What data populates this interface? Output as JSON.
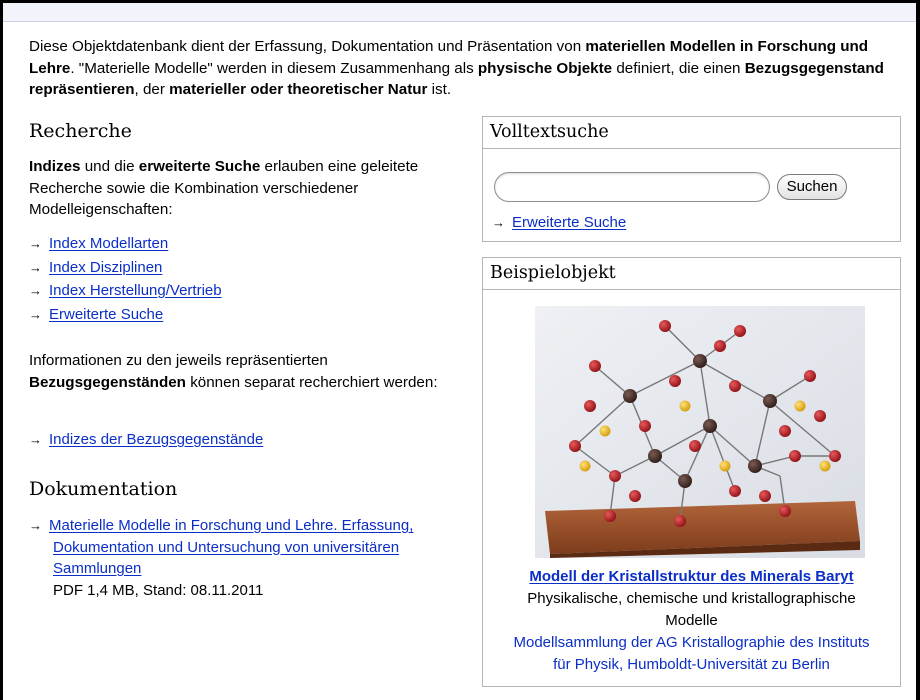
{
  "intro": {
    "p1": "Diese Objektdatenbank dient der Erfassung, Dokumentation und Präsentation von ",
    "b1": "materiellen Modellen in Forschung und Lehre",
    "p2": ". \"Materielle Modelle\" werden in diesem Zusammenhang als ",
    "b2": "physische Objekte",
    "p3": " definiert, die einen ",
    "b3": "Bezugsgegenstand repräsentieren",
    "p4": ", der ",
    "b4": "materieller oder theoretischer Natur",
    "p5": " ist."
  },
  "recherche": {
    "heading": "Recherche",
    "b1": "Indizes",
    "p1": " und die ",
    "b2": "erweiterte Suche",
    "p2": " erlauben eine geleitete Recherche sowie die Kombination verschiedener Modelleigenschaften:",
    "links": [
      "Index Modellarten",
      "Index Disziplinen",
      "Index Herstellung/Vertrieb",
      "Erweiterte Suche"
    ],
    "info_p1": "Informationen zu den jeweils repräsentierten ",
    "info_b": "Bezugsgegenständen",
    "info_p2": " können separat recherchiert werden:",
    "info_link": "Indizes der Bezugsgegenstände"
  },
  "dokumentation": {
    "heading": "Dokumentation",
    "link": "Materielle Modelle in Forschung und Lehre. Erfassung, Dokumentation und Untersuchung von universitären Sammlungen",
    "meta": "PDF 1,4 MB, Stand: 08.11.2011"
  },
  "volltextsuche": {
    "heading": "Volltextsuche",
    "input_value": "",
    "button": "Suchen",
    "link": "Erweiterte Suche"
  },
  "beispielobjekt": {
    "heading": "Beispielobjekt",
    "title": "Modell der Kristallstruktur des Minerals Baryt",
    "category": "Physikalische, chemische und kristallographische Modelle",
    "collection": "Modellsammlung der AG Kristallographie des Instituts für Physik, Humboldt-Universität zu Berlin"
  },
  "colors": {
    "link": "#0b2ec7",
    "box_border": "#b6b6b6",
    "frame": "#000000"
  }
}
